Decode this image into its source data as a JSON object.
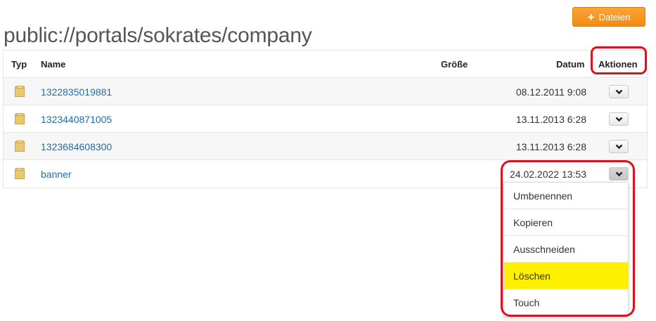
{
  "header": {
    "path_title": "public://portals/sokrates/company",
    "add_files_label": "Dateien"
  },
  "table": {
    "columns": {
      "type": "Typ",
      "name": "Name",
      "size": "Größe",
      "date": "Datum",
      "actions": "Aktionen"
    },
    "rows": [
      {
        "name": "1322835019881",
        "size": "",
        "date": "08.12.2011 9:08"
      },
      {
        "name": "1323440871005",
        "size": "",
        "date": "13.11.2013 6:28"
      },
      {
        "name": "1323684608300",
        "size": "",
        "date": "13.11.2013 6:28"
      },
      {
        "name": "banner",
        "size": "",
        "date": "24.02.2022 13:53"
      }
    ]
  },
  "actions_menu": {
    "items": [
      "Umbenennen",
      "Kopieren",
      "Ausschneiden",
      "Löschen",
      "Touch"
    ],
    "highlighted_item": "Löschen"
  },
  "colors": {
    "accent_orange": "#f7941d",
    "link_blue": "#1e6ea8",
    "annotation_red": "#e0101a",
    "highlight_yellow": "#fff000",
    "folder_tan": "#e8c872"
  },
  "icons": {
    "folder": "folder-icon",
    "plus": "plus-icon",
    "chevron": "chevron-down-icon"
  }
}
